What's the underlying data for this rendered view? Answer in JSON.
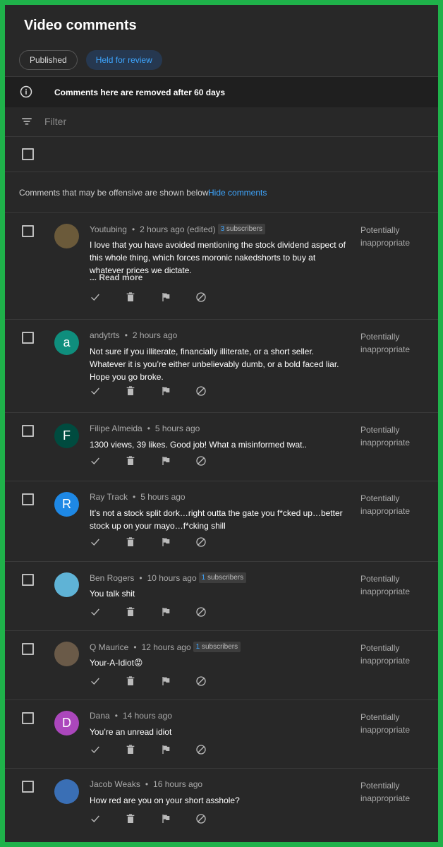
{
  "header": {
    "title": "Video comments"
  },
  "tabs": [
    {
      "label": "Published"
    },
    {
      "label": "Held for review"
    }
  ],
  "notice": {
    "text": "Comments here are removed after 60 days"
  },
  "filter": {
    "placeholder": "Filter"
  },
  "offensive": {
    "message": "Comments that may be offensive are shown below.",
    "link": "Hide comments"
  },
  "comments": [
    {
      "author": "Youtubing",
      "time": "2 hours ago (edited)",
      "subs_count": "3",
      "subs_label": "subscribers",
      "text": "I love that you have avoided mentioning the stock dividend aspect of this whole thing, which forces moronic nakedshorts to buy at whatever prices we dictate.",
      "read_more": "... Read more",
      "status": "Potentially inappropriate",
      "avatar_letter": "",
      "avatar_color": "#6b5a3a"
    },
    {
      "author": "andytrts",
      "time": "2 hours ago",
      "subs_count": "",
      "subs_label": "",
      "text": "Not sure if you illiterate, financially illiterate, or a short seller.  Whatever it is you’re either unbelievably dumb, or a bold faced liar.  Hope you go broke.",
      "read_more": "",
      "status": "Potentially inappropriate",
      "avatar_letter": "a",
      "avatar_color": "#0f8e7d"
    },
    {
      "author": "Filipe Almeida",
      "time": "5 hours ago",
      "subs_count": "",
      "subs_label": "",
      "text": "1300 views, 39 likes. Good job! What a misinformed twat..",
      "read_more": "",
      "status": "Potentially inappropriate",
      "avatar_letter": "F",
      "avatar_color": "#004b3f"
    },
    {
      "author": "Ray Track",
      "time": "5 hours ago",
      "subs_count": "",
      "subs_label": "",
      "text": "It’s not a stock split dork…right outta the gate you f*cked up…better stock up on your mayo…f*cking shill",
      "read_more": "",
      "status": "Potentially inappropriate",
      "avatar_letter": "R",
      "avatar_color": "#1e88e5"
    },
    {
      "author": "Ben Rogers",
      "time": "10 hours ago",
      "subs_count": "1",
      "subs_label": "subscribers",
      "text": "You talk shit",
      "read_more": "",
      "status": "Potentially inappropriate",
      "avatar_letter": "",
      "avatar_color": "#5fb3d6"
    },
    {
      "author": "Q Maurice",
      "time": "12 hours ago",
      "subs_count": "1",
      "subs_label": "subscribers",
      "text": "Your-A-Idiot😡",
      "read_more": "",
      "status": "Potentially inappropriate",
      "avatar_letter": "",
      "avatar_color": "#6a5a48"
    },
    {
      "author": "Dana",
      "time": "14 hours ago",
      "subs_count": "",
      "subs_label": "",
      "text": "You’re an unread idiot",
      "read_more": "",
      "status": "Potentially inappropriate",
      "avatar_letter": "D",
      "avatar_color": "#ab47bc"
    },
    {
      "author": "Jacob Weaks",
      "time": "16 hours ago",
      "subs_count": "",
      "subs_label": "",
      "text": "How red are you on your short asshole?",
      "read_more": "",
      "status": "Potentially inappropriate",
      "avatar_letter": "",
      "avatar_color": "#3a6fb5"
    }
  ],
  "actions": [
    "approve-icon",
    "delete-icon",
    "flag-icon",
    "block-icon"
  ],
  "colors": {
    "accent": "#3ea6ff",
    "background": "#282828",
    "border": "#1fb24a"
  }
}
